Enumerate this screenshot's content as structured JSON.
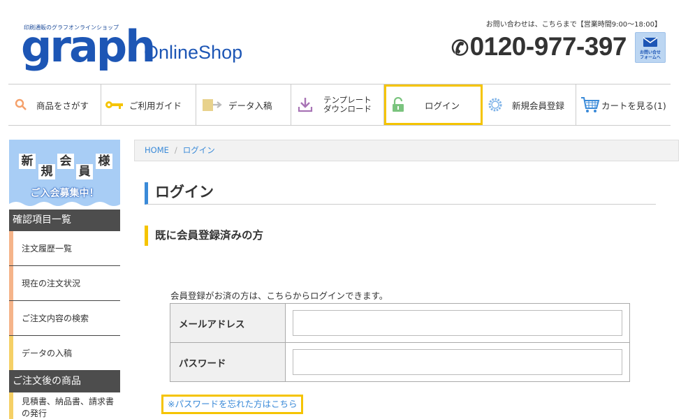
{
  "header": {
    "logo_tagline": "印刷通販のグラフオンラインショップ",
    "logo_main": "graph",
    "logo_sub": "OnlineShop",
    "contact_note": "お問い合わせは、こちらまで【営業時間9:00～18:00】",
    "phone": "0120-977-397",
    "contact_button_label_1": "お問い合せ",
    "contact_button_label_2": "フォームへ"
  },
  "nav": {
    "search": "商品をさがす",
    "guide": "ご利用ガイド",
    "data_upload": "データ入稿",
    "template_line1": "テンプレート",
    "template_line2": "ダウンロード",
    "login": "ログイン",
    "register": "新規会員登録",
    "cart": "カートを見る(1)"
  },
  "sidebar": {
    "banner_chars": [
      "新",
      "規",
      "会",
      "員",
      "様"
    ],
    "banner_sub": "ご入会募集中！",
    "section1_title": "確認項目一覧",
    "section1_items": [
      "注文履歴一覧",
      "現在の注文状況",
      "ご注文内容の検索",
      "データの入稿"
    ],
    "section2_title": "ご注文後の商品",
    "section2_items_line1": "見積書、納品書、請求書",
    "section2_items_line2": "の発行"
  },
  "breadcrumb": {
    "home": "HOME",
    "separator": "/",
    "current": "ログイン"
  },
  "main": {
    "page_title": "ログイン",
    "section_title": "既に会員登録済みの方",
    "intro": "会員登録がお済の方は、こちらからログインできます。",
    "email_label": "メールアドレス",
    "email_value": "",
    "password_label": "パスワード",
    "password_value": "",
    "forgot_link": "※パスワードを忘れた方はこちら"
  },
  "colors": {
    "brand_blue": "#1d56b5",
    "link_blue": "#3a8ad8",
    "highlight_yellow": "#f5c400",
    "sidebar_dark": "#4d4d4d"
  }
}
